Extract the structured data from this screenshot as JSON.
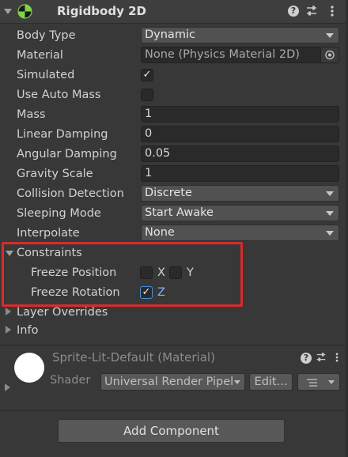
{
  "rigidbody": {
    "title": "Rigidbody 2D",
    "fields": {
      "body_type": {
        "label": "Body Type",
        "value": "Dynamic"
      },
      "material": {
        "label": "Material",
        "value": "None (Physics Material 2D)"
      },
      "simulated": {
        "label": "Simulated",
        "checked": "✓"
      },
      "use_auto_mass": {
        "label": "Use Auto Mass"
      },
      "mass": {
        "label": "Mass",
        "value": "1"
      },
      "linear_damping": {
        "label": "Linear Damping",
        "value": "0"
      },
      "angular_damping": {
        "label": "Angular Damping",
        "value": "0.05"
      },
      "gravity_scale": {
        "label": "Gravity Scale",
        "value": "1"
      },
      "collision_detection": {
        "label": "Collision Detection",
        "value": "Discrete"
      },
      "sleeping_mode": {
        "label": "Sleeping Mode",
        "value": "Start Awake"
      },
      "interpolate": {
        "label": "Interpolate",
        "value": "None"
      }
    },
    "constraints": {
      "label": "Constraints",
      "freeze_position": {
        "label": "Freeze Position",
        "x": "X",
        "y": "Y"
      },
      "freeze_rotation": {
        "label": "Freeze Rotation",
        "z": "Z",
        "checked": "✓"
      }
    },
    "layer_overrides": "Layer Overrides",
    "info": "Info"
  },
  "material_panel": {
    "title": "Sprite-Lit-Default (Material)",
    "shader_label": "Shader",
    "shader_value": "Universal Render Pipel",
    "edit_label": "Edit..."
  },
  "add_component": "Add Component",
  "colors": {
    "background": "#383838",
    "highlight_box": "#d92b2b",
    "check_accent": "#4a90d9"
  }
}
